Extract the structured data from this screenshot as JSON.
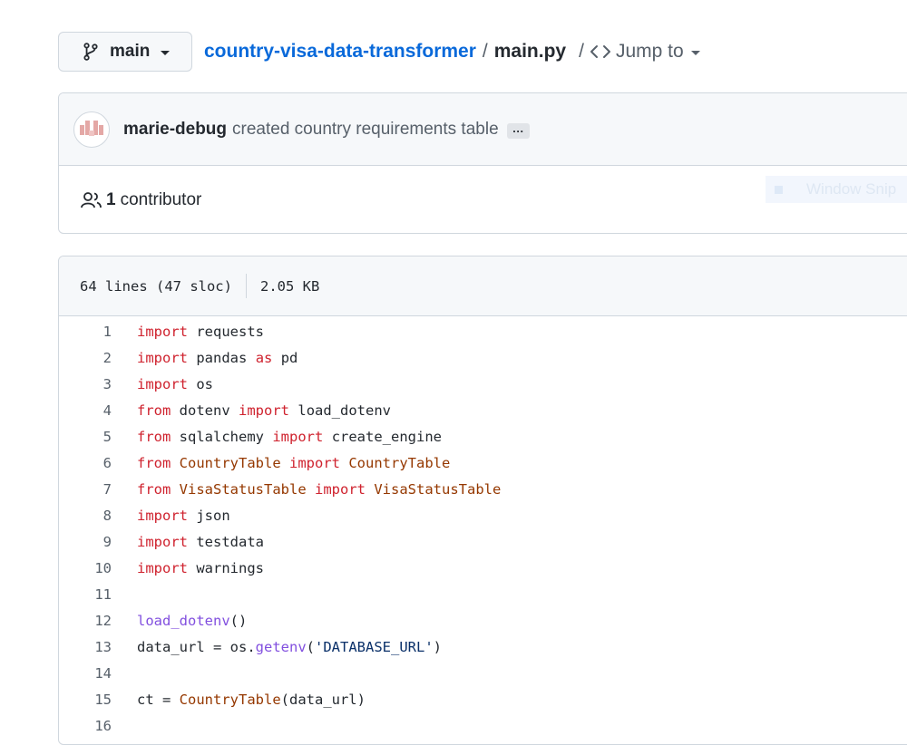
{
  "branch": {
    "name": "main"
  },
  "breadcrumb": {
    "repo": "country-visa-data-transformer",
    "separator": "/",
    "file": "main.py",
    "jump_sep": "/",
    "jump_label": "Jump to"
  },
  "commit": {
    "author": "marie-debug",
    "message": "created country requirements table",
    "more": "…"
  },
  "contributors": {
    "count": "1",
    "label": "contributor"
  },
  "overlay": {
    "window_snip": "Window Snip"
  },
  "file_info": {
    "lines": "64 lines (47 sloc)",
    "size": "2.05 KB"
  },
  "code_lines": [
    {
      "n": "1",
      "tokens": [
        [
          "kw",
          "import"
        ],
        [
          "",
          "requests"
        ]
      ]
    },
    {
      "n": "2",
      "tokens": [
        [
          "kw",
          "import"
        ],
        [
          "",
          "pandas"
        ],
        [
          "kw",
          "as"
        ],
        [
          "",
          "pd"
        ]
      ]
    },
    {
      "n": "3",
      "tokens": [
        [
          "kw",
          "import"
        ],
        [
          "",
          "os"
        ]
      ]
    },
    {
      "n": "4",
      "tokens": [
        [
          "kw",
          "from"
        ],
        [
          "",
          "dotenv"
        ],
        [
          "kw",
          "import"
        ],
        [
          "",
          "load_dotenv"
        ]
      ]
    },
    {
      "n": "5",
      "tokens": [
        [
          "kw",
          "from"
        ],
        [
          "",
          "sqlalchemy"
        ],
        [
          "kw",
          "import"
        ],
        [
          "",
          "create_engine"
        ]
      ]
    },
    {
      "n": "6",
      "tokens": [
        [
          "kw",
          "from"
        ],
        [
          "cls",
          "CountryTable"
        ],
        [
          "kw",
          "import"
        ],
        [
          "cls",
          "CountryTable"
        ]
      ]
    },
    {
      "n": "7",
      "tokens": [
        [
          "kw",
          "from"
        ],
        [
          "cls",
          "VisaStatusTable"
        ],
        [
          "kw",
          "import"
        ],
        [
          "cls",
          "VisaStatusTable"
        ]
      ]
    },
    {
      "n": "8",
      "tokens": [
        [
          "kw",
          "import"
        ],
        [
          "",
          "json"
        ]
      ]
    },
    {
      "n": "9",
      "tokens": [
        [
          "kw",
          "import"
        ],
        [
          "",
          "testdata"
        ]
      ]
    },
    {
      "n": "10",
      "tokens": [
        [
          "kw",
          "import"
        ],
        [
          "",
          "warnings"
        ]
      ]
    },
    {
      "n": "11",
      "tokens": []
    },
    {
      "n": "12",
      "tokens": [
        [
          "fn",
          "load_dotenv"
        ],
        [
          "",
          "()"
        ]
      ]
    },
    {
      "n": "13",
      "tokens": [
        [
          "",
          "data_url = os."
        ],
        [
          "fn",
          "getenv"
        ],
        [
          "",
          "("
        ],
        [
          "str",
          "'DATABASE_URL'"
        ],
        [
          "",
          ")"
        ]
      ]
    },
    {
      "n": "14",
      "tokens": []
    },
    {
      "n": "15",
      "tokens": [
        [
          "",
          "ct = "
        ],
        [
          "cls",
          "CountryTable"
        ],
        [
          "",
          "(data_url)"
        ]
      ]
    },
    {
      "n": "16",
      "tokens": []
    }
  ],
  "colors": {
    "link": "#0969da",
    "keyword": "#cf222e",
    "class": "#953800",
    "function": "#8250df",
    "string": "#0a3069"
  }
}
